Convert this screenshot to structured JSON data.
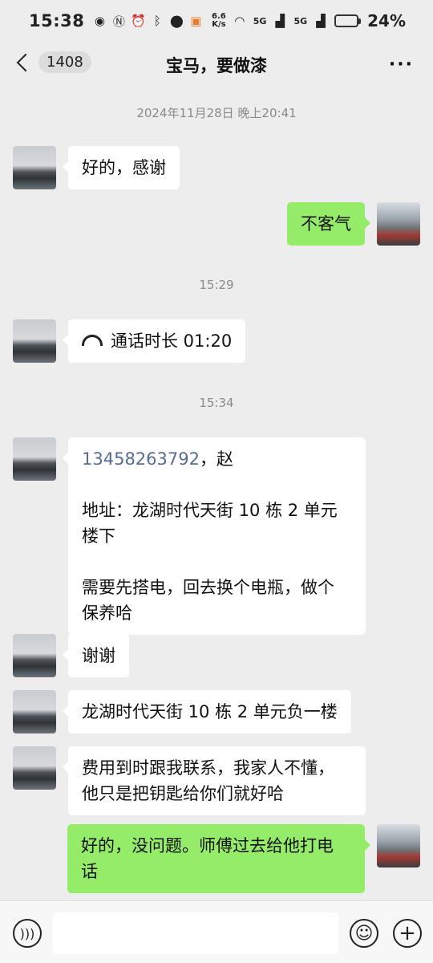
{
  "status_bar": {
    "time": "15:38",
    "speed_top": "6.6",
    "speed_bottom": "K/s",
    "signal1": "5G",
    "signal2": "5G",
    "battery_level": 0.24,
    "battery_text": "24%"
  },
  "header": {
    "unread_count": "1408",
    "title": "宝马，要做漆",
    "more_label": "···"
  },
  "messages": [
    {
      "type": "timestamp",
      "text": "2024年11月28日 晚上20:41"
    },
    {
      "type": "text",
      "side": "left",
      "text": "好的，感谢"
    },
    {
      "type": "text",
      "side": "right",
      "text": "不客气"
    },
    {
      "type": "timestamp",
      "text": "15:29"
    },
    {
      "type": "call",
      "side": "left",
      "text": "通话时长 01:20"
    },
    {
      "type": "timestamp",
      "text": "15:34"
    },
    {
      "type": "text",
      "side": "left",
      "phone": "13458263792",
      "phone_suffix": "，赵",
      "text": "地址：龙湖时代天街 10 栋 2 单元\n楼下\n\n需要先搭电，回去换个电瓶，做个\n保养哈"
    },
    {
      "type": "text",
      "side": "left",
      "text": "谢谢"
    },
    {
      "type": "text",
      "side": "left",
      "text": "龙湖时代天街 10 栋 2 单元负一楼"
    },
    {
      "type": "text",
      "side": "left",
      "text": "费用到时跟我联系，我家人不懂，\n他只是把钥匙给你们就好哈"
    },
    {
      "type": "text",
      "side": "right",
      "text": "好的，没问题。师傅过去给他打电\n话"
    }
  ],
  "input_bar": {
    "placeholder": "",
    "emoji_icon": "☺",
    "plus_icon": "+"
  }
}
